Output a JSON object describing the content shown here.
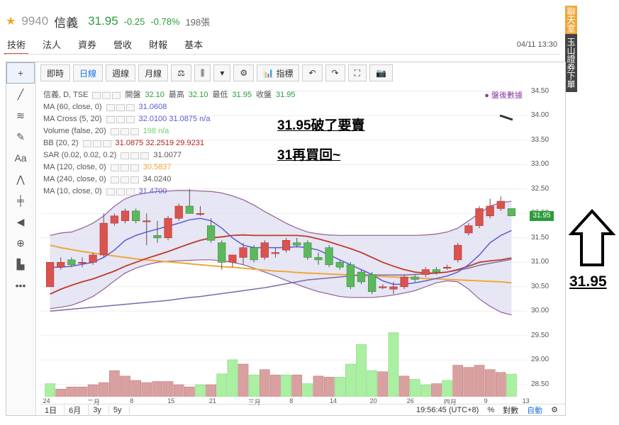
{
  "header": {
    "star": "★",
    "code": "9940",
    "name": "信義",
    "price": "31.95",
    "change": "-0.25",
    "change_pct": "-0.78%",
    "volume": "198張"
  },
  "tabs": [
    "技術",
    "法人",
    "資券",
    "營收",
    "財報",
    "基本"
  ],
  "datetime": "04/11 13:30",
  "side_banner": {
    "top": "聊天室",
    "bottom": "玉山證券下單"
  },
  "toolbar": {
    "intraday": "即時",
    "daily": "日線",
    "weekly": "週線",
    "monthly": "月線",
    "indicators": "指標"
  },
  "legend": {
    "main": "信義, D, TSE",
    "ohlc_label_open": "開盤",
    "ohlc_open": "32.10",
    "ohlc_label_high": "最高",
    "ohlc_high": "32.10",
    "ohlc_label_low": "最低",
    "ohlc_low": "31.95",
    "ohlc_label_close": "收盤",
    "ohlc_close": "31.95",
    "rows": [
      {
        "label": "MA (60, close, 0)",
        "value": "31.0608",
        "color": "#5b5bd6"
      },
      {
        "label": "MA Cross (5, 20)",
        "value": "32.0100  31.0875  n/a",
        "color": "#5b5bd6"
      },
      {
        "label": "Volume (false, 20)",
        "value": "198  n/a",
        "color": "#6ccf6c"
      },
      {
        "label": "BB (20, 2)",
        "value": "31.0875  32.2519  29.9231",
        "color": "#b22222"
      },
      {
        "label": "SAR (0.02, 0.02, 0.2)",
        "value": "31.0077",
        "color": "#555555"
      },
      {
        "label": "MA (120, close, 0)",
        "value": "30.5837",
        "color": "#f0a73a"
      },
      {
        "label": "MA (240, close, 0)",
        "value": "34.0240",
        "color": "#555555"
      },
      {
        "label": "MA (10, close, 0)",
        "value": "31.4700",
        "color": "#5b5bd6"
      }
    ]
  },
  "after_hours": "● 盤後數據",
  "notes": {
    "line1": "31.95破了要賣",
    "line2": "31再買回~"
  },
  "annotation_price": "31.95",
  "y_axis": [
    "34.50",
    "34.00",
    "33.50",
    "33.00",
    "32.50",
    "32.00",
    "31.50",
    "31.00",
    "30.50",
    "30.00",
    "29.50",
    "29.00",
    "28.50"
  ],
  "current_price_tag": "31.95",
  "x_axis": [
    "24",
    "二月",
    "8",
    "15",
    "21",
    "三月",
    "8",
    "14",
    "20",
    "26",
    "四月",
    "9",
    "13"
  ],
  "bottom": {
    "ranges": [
      "1日",
      "6月",
      "3y",
      "5y"
    ],
    "time": "19:56:45 (UTC+8)",
    "pct": "%",
    "log": "對數",
    "auto": "自動"
  },
  "colors": {
    "up": "#d9534f",
    "down": "#5cb85c",
    "band_fill": "#dcdcf0",
    "accent": "#1a73e8"
  },
  "chart_data": {
    "type": "candlestick",
    "ylim": [
      28.25,
      34.6
    ],
    "candles": [
      {
        "o": 30.5,
        "h": 31.0,
        "l": 30.5,
        "c": 31.0
      },
      {
        "o": 30.9,
        "h": 31.1,
        "l": 30.85,
        "c": 31.0
      },
      {
        "o": 31.05,
        "h": 31.1,
        "l": 30.9,
        "c": 30.95
      },
      {
        "o": 31.0,
        "h": 31.1,
        "l": 30.9,
        "c": 31.0
      },
      {
        "o": 31.0,
        "h": 31.2,
        "l": 30.95,
        "c": 31.15
      },
      {
        "o": 31.15,
        "h": 32.0,
        "l": 31.1,
        "c": 31.8
      },
      {
        "o": 31.8,
        "h": 32.0,
        "l": 31.75,
        "c": 31.95
      },
      {
        "o": 31.85,
        "h": 32.1,
        "l": 31.8,
        "c": 32.05
      },
      {
        "o": 32.05,
        "h": 32.1,
        "l": 31.8,
        "c": 31.85
      },
      {
        "o": 31.85,
        "h": 32.0,
        "l": 31.35,
        "c": 31.85
      },
      {
        "o": 31.55,
        "h": 31.85,
        "l": 31.4,
        "c": 31.5
      },
      {
        "o": 31.5,
        "h": 31.95,
        "l": 31.45,
        "c": 31.9
      },
      {
        "o": 31.9,
        "h": 32.2,
        "l": 31.85,
        "c": 32.15
      },
      {
        "o": 32.15,
        "h": 32.5,
        "l": 32.0,
        "c": 32.0
      },
      {
        "o": 32.0,
        "h": 32.15,
        "l": 31.95,
        "c": 32.0
      },
      {
        "o": 31.75,
        "h": 31.9,
        "l": 31.4,
        "c": 31.45
      },
      {
        "o": 31.4,
        "h": 31.45,
        "l": 30.85,
        "c": 31.0
      },
      {
        "o": 31.0,
        "h": 31.1,
        "l": 30.9,
        "c": 31.15
      },
      {
        "o": 31.1,
        "h": 31.4,
        "l": 30.95,
        "c": 31.3
      },
      {
        "o": 31.3,
        "h": 31.35,
        "l": 31.0,
        "c": 31.05
      },
      {
        "o": 31.1,
        "h": 31.45,
        "l": 31.05,
        "c": 31.4
      },
      {
        "o": 31.2,
        "h": 31.3,
        "l": 31.1,
        "c": 31.2
      },
      {
        "o": 31.25,
        "h": 31.5,
        "l": 31.2,
        "c": 31.45
      },
      {
        "o": 31.4,
        "h": 31.5,
        "l": 31.3,
        "c": 31.35
      },
      {
        "o": 31.4,
        "h": 31.45,
        "l": 31.05,
        "c": 31.1
      },
      {
        "o": 31.1,
        "h": 31.2,
        "l": 30.95,
        "c": 31.05
      },
      {
        "o": 31.3,
        "h": 31.35,
        "l": 30.9,
        "c": 30.95
      },
      {
        "o": 31.0,
        "h": 31.05,
        "l": 30.85,
        "c": 30.9
      },
      {
        "o": 30.95,
        "h": 31.0,
        "l": 30.45,
        "c": 30.5
      },
      {
        "o": 30.8,
        "h": 30.85,
        "l": 30.55,
        "c": 30.6
      },
      {
        "o": 30.75,
        "h": 30.8,
        "l": 30.35,
        "c": 30.4
      },
      {
        "o": 30.5,
        "h": 30.55,
        "l": 30.45,
        "c": 30.5
      },
      {
        "o": 30.45,
        "h": 30.6,
        "l": 30.35,
        "c": 30.5
      },
      {
        "o": 30.5,
        "h": 30.75,
        "l": 30.45,
        "c": 30.7
      },
      {
        "o": 30.7,
        "h": 30.75,
        "l": 30.6,
        "c": 30.65
      },
      {
        "o": 30.75,
        "h": 30.9,
        "l": 30.7,
        "c": 30.85
      },
      {
        "o": 30.85,
        "h": 30.9,
        "l": 30.75,
        "c": 30.8
      },
      {
        "o": 30.9,
        "h": 30.95,
        "l": 30.85,
        "c": 30.9
      },
      {
        "o": 31.05,
        "h": 31.4,
        "l": 31.0,
        "c": 31.35
      },
      {
        "o": 31.6,
        "h": 31.8,
        "l": 31.55,
        "c": 31.75
      },
      {
        "o": 31.75,
        "h": 32.15,
        "l": 31.7,
        "c": 32.1
      },
      {
        "o": 31.95,
        "h": 32.3,
        "l": 31.9,
        "c": 32.15
      },
      {
        "o": 32.1,
        "h": 32.35,
        "l": 32.05,
        "c": 32.25
      },
      {
        "o": 32.1,
        "h": 32.1,
        "l": 31.95,
        "c": 31.95
      }
    ],
    "bb_upper": [
      31.55,
      31.6,
      31.62,
      31.7,
      31.8,
      31.95,
      32.15,
      32.3,
      32.38,
      32.42,
      32.45,
      32.46,
      32.47,
      32.47,
      32.46,
      32.45,
      32.42,
      32.36,
      32.28,
      32.17,
      32.04,
      31.92,
      31.8,
      31.7,
      31.62,
      31.58,
      31.56,
      31.55,
      31.55,
      31.55,
      31.55,
      31.55,
      31.55,
      31.55,
      31.55,
      31.56,
      31.58,
      31.62,
      31.7,
      31.85,
      32.0,
      32.15,
      32.22,
      32.25
    ],
    "bb_lower": [
      30.05,
      30.08,
      30.12,
      30.2,
      30.3,
      30.45,
      30.62,
      30.78,
      30.88,
      30.95,
      31.0,
      31.02,
      31.03,
      31.04,
      31.05,
      31.05,
      31.03,
      31.0,
      30.95,
      30.88,
      30.8,
      30.72,
      30.63,
      30.55,
      30.47,
      30.4,
      30.35,
      30.3,
      30.28,
      30.28,
      30.28,
      30.3,
      30.33,
      30.37,
      30.42,
      30.5,
      30.58,
      30.62,
      30.6,
      30.45,
      30.25,
      30.1,
      29.98,
      29.92
    ],
    "ma10": [
      30.9,
      30.9,
      30.92,
      30.96,
      31.0,
      31.1,
      31.25,
      31.45,
      31.55,
      31.62,
      31.68,
      31.74,
      31.8,
      31.87,
      31.9,
      31.85,
      31.7,
      31.5,
      31.35,
      31.3,
      31.3,
      31.3,
      31.3,
      31.32,
      31.3,
      31.25,
      31.15,
      31.05,
      30.95,
      30.85,
      30.75,
      30.62,
      30.55,
      30.55,
      30.58,
      30.62,
      30.67,
      30.72,
      30.8,
      30.95,
      31.15,
      31.4,
      31.55,
      31.65
    ],
    "ma20": [
      30.35,
      30.45,
      30.53,
      30.6,
      30.66,
      30.74,
      30.82,
      30.92,
      31.0,
      31.08,
      31.15,
      31.22,
      31.3,
      31.38,
      31.45,
      31.5,
      31.52,
      31.55,
      31.56,
      31.55,
      31.55,
      31.55,
      31.55,
      31.55,
      31.53,
      31.48,
      31.42,
      31.35,
      31.28,
      31.2,
      31.1,
      31.0,
      30.92,
      30.85,
      30.8,
      30.78,
      30.78,
      30.8,
      30.85,
      30.92,
      31.0,
      31.03,
      31.05,
      31.09
    ],
    "ma60": [
      30.0,
      30.02,
      30.04,
      30.06,
      30.08,
      30.1,
      30.12,
      30.14,
      30.16,
      30.18,
      30.2,
      30.22,
      30.25,
      30.28,
      30.3,
      30.33,
      30.36,
      30.39,
      30.42,
      30.45,
      30.48,
      30.52,
      30.56,
      30.6,
      30.64,
      30.66,
      30.68,
      30.7,
      30.72,
      30.74,
      30.74,
      30.74,
      30.74,
      30.74,
      30.75,
      30.76,
      30.78,
      30.8,
      30.84,
      30.88,
      30.94,
      30.98,
      31.02,
      31.06
    ],
    "ma120": [
      31.35,
      31.3,
      31.26,
      31.22,
      31.19,
      31.16,
      31.13,
      31.1,
      31.07,
      31.05,
      31.03,
      31.01,
      30.99,
      30.97,
      30.95,
      30.93,
      30.91,
      30.9,
      30.88,
      30.86,
      30.84,
      30.82,
      30.81,
      30.79,
      30.78,
      30.77,
      30.76,
      30.75,
      30.74,
      30.73,
      30.72,
      30.71,
      30.7,
      30.69,
      30.68,
      30.67,
      30.66,
      30.65,
      30.64,
      30.63,
      30.62,
      30.61,
      30.6,
      30.58
    ],
    "volume": [
      60,
      35,
      45,
      45,
      55,
      65,
      120,
      95,
      75,
      65,
      70,
      70,
      55,
      45,
      55,
      55,
      105,
      170,
      150,
      100,
      125,
      100,
      100,
      100,
      60,
      95,
      90,
      90,
      150,
      240,
      120,
      115,
      295,
      95,
      80,
      55,
      60,
      75,
      145,
      135,
      145,
      125,
      112,
      104
    ],
    "volume_up": [
      false,
      true,
      true,
      true,
      true,
      true,
      true,
      true,
      true,
      true,
      true,
      true,
      true,
      true,
      false,
      true,
      false,
      false,
      true,
      false,
      true,
      true,
      false,
      true,
      false,
      true,
      true,
      false,
      false,
      false,
      false,
      true,
      false,
      true,
      false,
      false,
      true,
      false,
      true,
      true,
      true,
      true,
      true,
      false
    ]
  }
}
